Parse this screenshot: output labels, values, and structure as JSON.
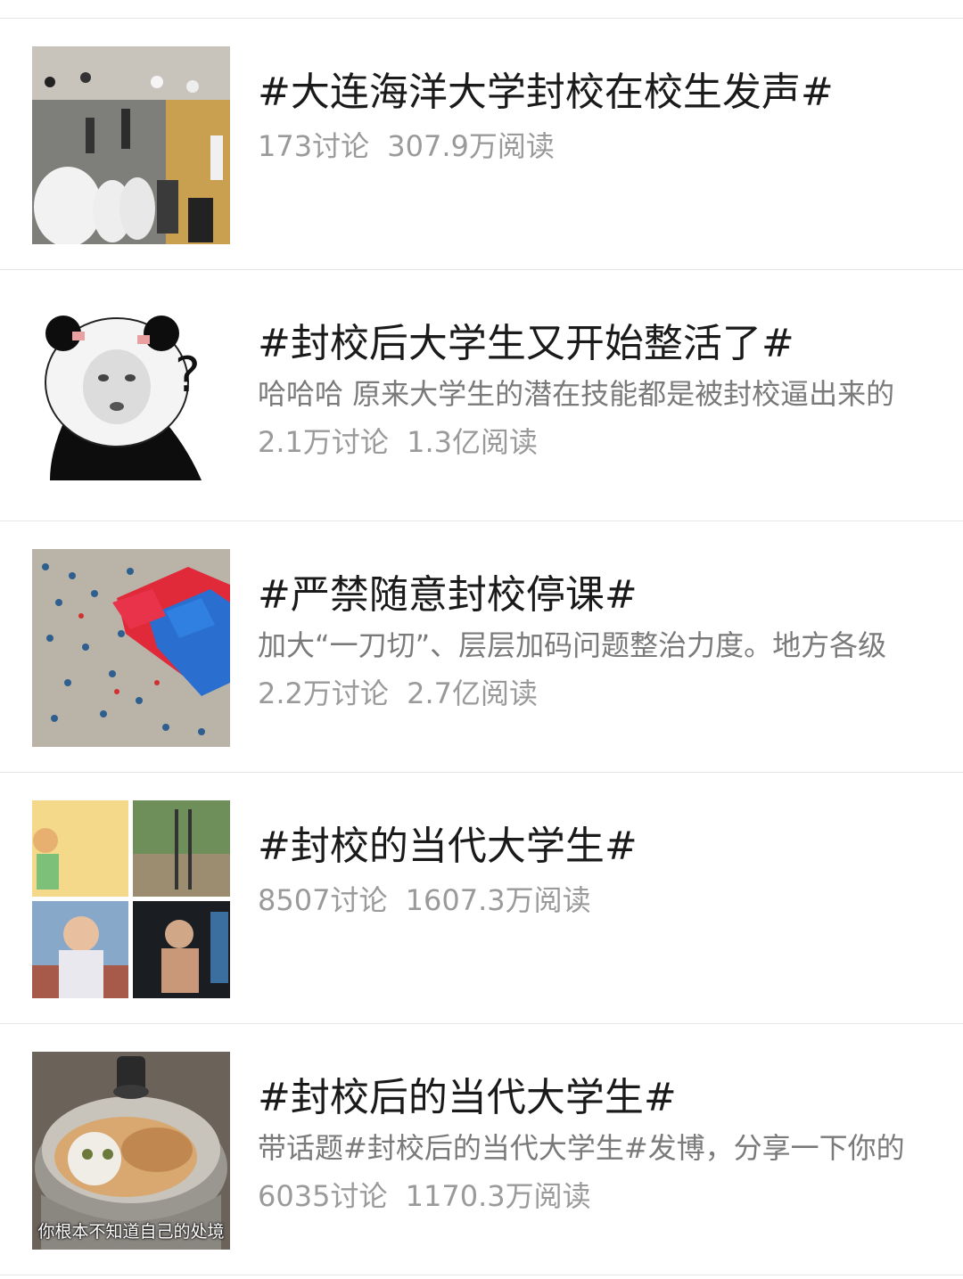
{
  "topics": [
    {
      "title": "#大连海洋大学封校在校生发声#",
      "desc": "",
      "discussions": "173讨论",
      "reads": "307.9万阅读",
      "thumb_caption": ""
    },
    {
      "title": "#封校后大学生又开始整活了#",
      "desc": "哈哈哈 原来大学生的潜在技能都是被封校逼出来的",
      "discussions": "2.1万讨论",
      "reads": "1.3亿阅读",
      "thumb_caption": ""
    },
    {
      "title": "#严禁随意封校停课#",
      "desc": "加大“一刀切”、层层加码问题整治力度。地方各级",
      "discussions": "2.2万讨论",
      "reads": "2.7亿阅读",
      "thumb_caption": ""
    },
    {
      "title": "#封校的当代大学生#",
      "desc": "",
      "discussions": "8507讨论",
      "reads": "1607.3万阅读",
      "thumb_caption": ""
    },
    {
      "title": "#封校后的当代大学生#",
      "desc": "带话题#封校后的当代大学生#发博，分享一下你的",
      "discussions": "6035讨论",
      "reads": "1170.3万阅读",
      "thumb_caption": "你根本不知道自己的处境"
    }
  ]
}
